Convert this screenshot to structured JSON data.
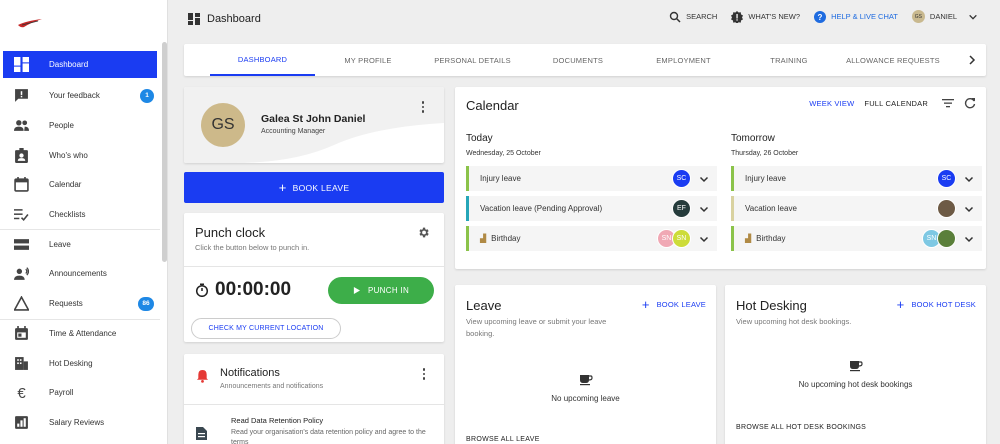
{
  "sidebar": {
    "logo": "company-logo",
    "items": [
      {
        "label": "Dashboard",
        "icon": "dashboard-icon",
        "active": true
      },
      {
        "label": "Your feedback",
        "icon": "feedback-icon",
        "badge": "1"
      },
      {
        "label": "People",
        "icon": "people-icon"
      },
      {
        "label": "Who's who",
        "icon": "contact-badge-icon"
      },
      {
        "label": "Calendar",
        "icon": "calendar-icon"
      },
      {
        "label": "Checklists",
        "icon": "checklist-icon"
      },
      {
        "label": "Leave",
        "icon": "leave-icon"
      },
      {
        "label": "Announcements",
        "icon": "announcements-icon"
      },
      {
        "label": "Requests",
        "icon": "requests-icon",
        "badge": "86"
      },
      {
        "label": "Time & Attendance",
        "icon": "time-attendance-icon"
      },
      {
        "label": "Hot Desking",
        "icon": "hot-desking-icon"
      },
      {
        "label": "Payroll",
        "icon": "euro-icon"
      },
      {
        "label": "Salary Reviews",
        "icon": "salary-reviews-icon"
      }
    ]
  },
  "header": {
    "title": "Dashboard",
    "search": "SEARCH",
    "whats_new": "WHAT'S NEW?",
    "help": "HELP & LIVE CHAT",
    "user_initials": "GS",
    "user": "DANIEL"
  },
  "tabs": [
    "DASHBOARD",
    "MY PROFILE",
    "PERSONAL DETAILS",
    "DOCUMENTS",
    "EMPLOYMENT",
    "TRAINING",
    "ALLOWANCE REQUESTS"
  ],
  "profile": {
    "initials": "GS",
    "name": "Galea St John Daniel",
    "role": "Accounting Manager"
  },
  "book_leave": "BOOK LEAVE",
  "punch": {
    "title": "Punch clock",
    "subtitle": "Click the button below to punch in.",
    "time": "00:00:00",
    "punch_in": "PUNCH IN",
    "location": "CHECK MY CURRENT LOCATION"
  },
  "notifications": {
    "title": "Notifications",
    "subtitle": "Announcements and notifications",
    "item_title": "Read Data Retention Policy",
    "item_body": "Read your organisation's data retention policy and agree to the terms"
  },
  "calendar": {
    "title": "Calendar",
    "week_view": "WEEK VIEW",
    "full_calendar": "FULL CALENDAR",
    "today": {
      "label": "Today",
      "date": "Wednesday, 25 October",
      "events": [
        {
          "label": "Injury leave",
          "color": "#8bc34a",
          "avatars": [
            {
              "t": "SC",
              "c": "#1a3cf2"
            }
          ]
        },
        {
          "label": "Vacation leave (Pending Approval)",
          "color": "#26a6b8",
          "avatars": [
            {
              "t": "EF",
              "c": "#263c3c"
            }
          ]
        },
        {
          "label": "Birthday",
          "color": "#8bc34a",
          "cake": true,
          "avatars": [
            {
              "t": "SN",
              "c": "#f0a8b4"
            },
            {
              "t": "SN",
              "c": "#cddc39"
            }
          ]
        }
      ]
    },
    "tomorrow": {
      "label": "Tomorrow",
      "date": "Thursday, 26 October",
      "events": [
        {
          "label": "Injury leave",
          "color": "#8bc34a",
          "avatars": [
            {
              "t": "SC",
              "c": "#1a3cf2"
            }
          ]
        },
        {
          "label": "Vacation leave",
          "color": "#d9d2a0",
          "avatars": [
            {
              "t": "",
              "c": "#6d5a45"
            }
          ]
        },
        {
          "label": "Birthday",
          "color": "#8bc34a",
          "cake": true,
          "avatars": [
            {
              "t": "SN",
              "c": "#7ec8e3"
            },
            {
              "t": "",
              "c": "#5a7f3a"
            }
          ]
        }
      ]
    }
  },
  "leave": {
    "title": "Leave",
    "action": "BOOK LEAVE",
    "subtitle": "View upcoming leave or submit your leave booking.",
    "empty": "No upcoming leave",
    "link": "BROWSE ALL LEAVE"
  },
  "hotdesk": {
    "title": "Hot Desking",
    "action": "BOOK HOT DESK",
    "subtitle": "View upcoming hot desk bookings.",
    "empty": "No upcoming hot desk bookings",
    "link": "BROWSE ALL HOT DESK BOOKINGS"
  }
}
